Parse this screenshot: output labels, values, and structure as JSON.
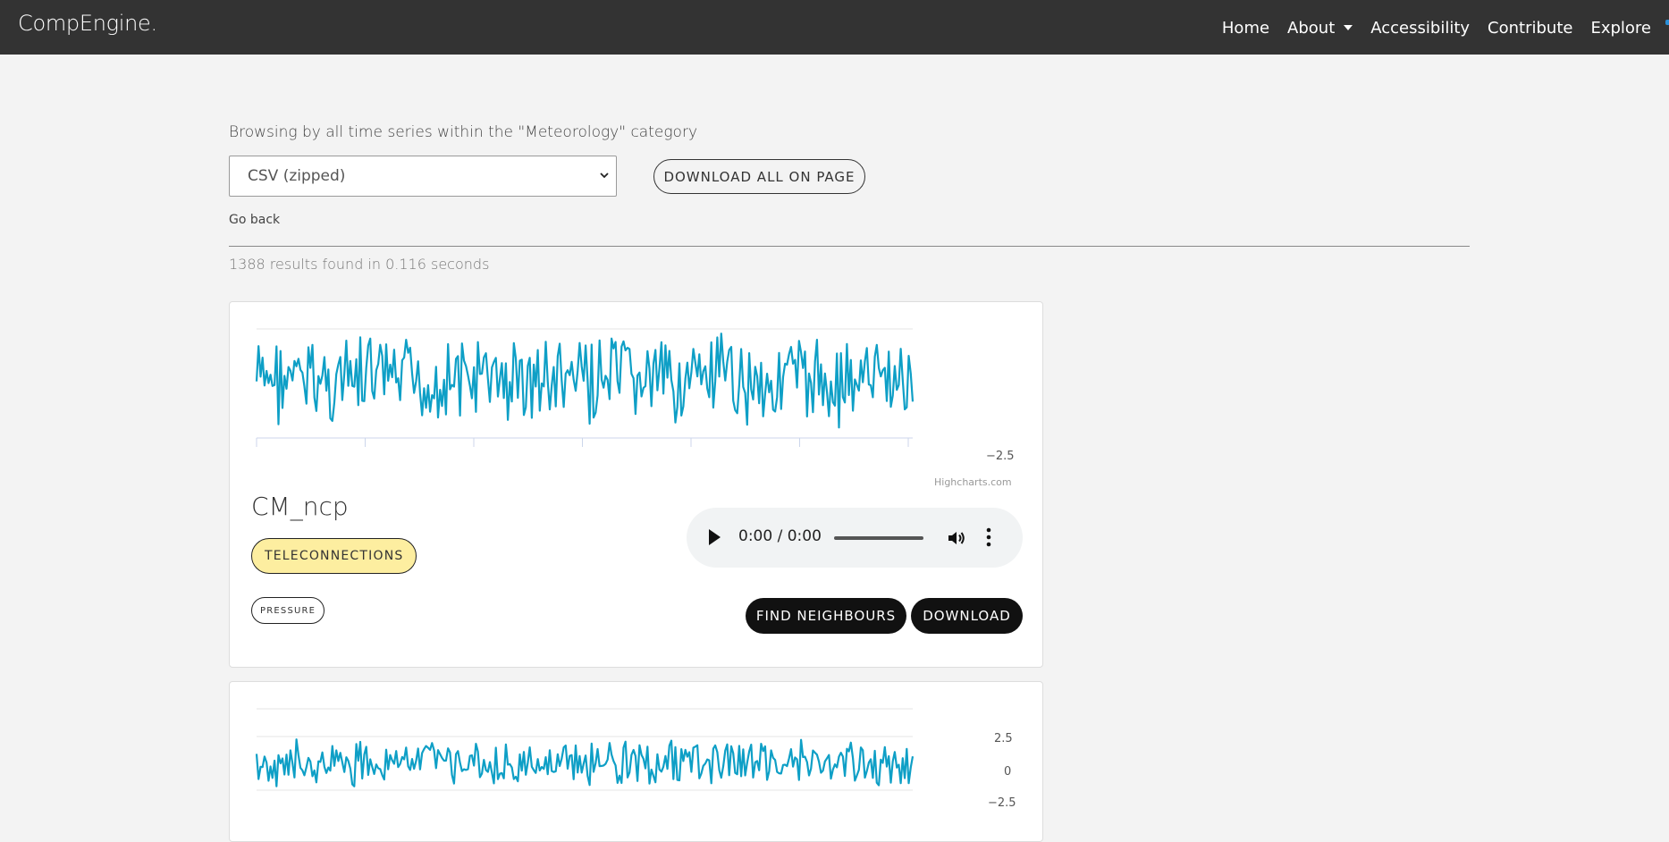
{
  "navbar": {
    "brand": "CompEngine.",
    "links": [
      "Home",
      "About",
      "Accessibility",
      "Contribute",
      "Explore"
    ]
  },
  "browse": {
    "heading": "Browsing by all time series within the \"Meteorology\" category",
    "format_select": "CSV (zipped)",
    "download_all": "DOWNLOAD ALL ON PAGE",
    "go_back": "Go back",
    "results_text": "1388 results found in 0.116 seconds"
  },
  "cards": [
    {
      "title": "CM_ncp",
      "primary_tag": "TELECONNECTIONS",
      "secondary_tag": "PRESSURE",
      "audio_time": "0:00 / 0:00",
      "find_neighbours": "FIND NEIGHBOURS",
      "download": "DOWNLOAD",
      "credit": "Highcharts.com",
      "axis_labels": [
        "−2.5"
      ]
    },
    {
      "axis_labels": [
        "2.5",
        "0",
        "−2.5"
      ]
    }
  ],
  "colors": {
    "series": "#0e9fc6",
    "navbar": "#333333",
    "tag_primary_bg": "#fdeea0"
  },
  "chart_data": [
    {
      "type": "line",
      "x": [],
      "series": [],
      "yticks": [
        "−2.5"
      ],
      "grid": true
    },
    {
      "type": "line",
      "x": [],
      "series": [],
      "yticks": [
        "2.5",
        "0",
        "−2.5"
      ],
      "grid": true
    }
  ]
}
